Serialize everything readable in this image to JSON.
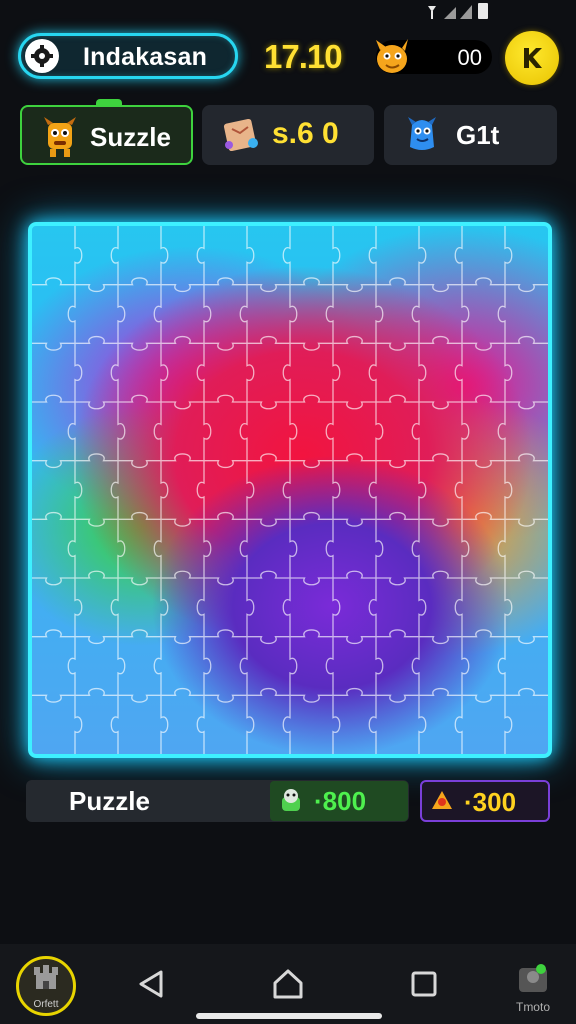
{
  "header": {
    "player_name": "Indakasan",
    "score": "17.10",
    "coins": "00"
  },
  "tabs": [
    {
      "label": "Suzzle",
      "active": true
    },
    {
      "label": "s.6 0",
      "active": false
    },
    {
      "label": "G1t",
      "active": false
    }
  ],
  "bottom": {
    "title": "Puzzle",
    "green_value": "·800",
    "purple_value": "·300"
  },
  "nav": {
    "home_label": "Orfett",
    "profile_label": "Tmoto"
  },
  "colors": {
    "accent_cyan": "#3ef0ff",
    "score_yellow": "#ffe033",
    "green": "#4ef04e",
    "purple_border": "#7a3fd8"
  },
  "icons": {
    "player": "gear-icon",
    "coins": "mascot-icon",
    "action": "k-badge-icon",
    "tab1": "monster-icon",
    "tab2": "map-scroll-icon",
    "tab3": "blue-creature-icon",
    "green_pill": "pet-icon",
    "purple_pill": "bell-icon"
  }
}
